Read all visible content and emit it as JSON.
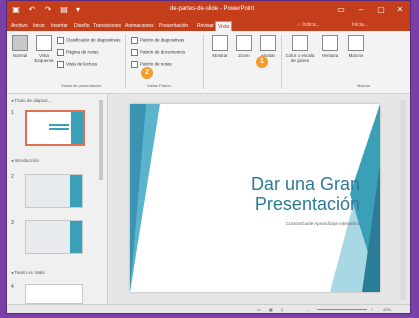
{
  "window": {
    "title": "de-partes-de-slide - PowerPoint",
    "qa_icons": [
      "save-icon",
      "undo-icon",
      "redo-icon",
      "present-icon",
      "customize-icon"
    ],
    "controls": [
      "ribbon-options-icon",
      "minimize-icon",
      "maximize-icon",
      "close-icon"
    ]
  },
  "tabs": [
    {
      "label": "Archivo",
      "active": false
    },
    {
      "label": "Inicio",
      "active": false
    },
    {
      "label": "Insertar",
      "active": false
    },
    {
      "label": "Diseño",
      "active": false
    },
    {
      "label": "Transiciones",
      "active": false
    },
    {
      "label": "Animaciones",
      "active": false
    },
    {
      "label": "Presentación",
      "active": false
    },
    {
      "label": "Revisar",
      "active": false
    },
    {
      "label": "Vista",
      "active": true
    }
  ],
  "tell_me": "♀ Indica...",
  "sign_in": "Inicia...",
  "ribbon": {
    "normal_label": "Normal",
    "outline_label": "Vista Esquema",
    "slide_sorter": "Clasificador de diapositivas",
    "notes_page": "Página de notas",
    "reading_view": "Vista de lectura",
    "views_group": "Vistas de presentación",
    "slide_master": "Patrón de diapositivas",
    "handout_master": "Patrón de documentos",
    "notes_master": "Patrón de notas",
    "master_group": "Vistas Patrón",
    "show_label": "Mostrar",
    "zoom_label": "Zoom",
    "fit_label": "Ajustar",
    "color_label": "Color o escala de grises",
    "window_label": "Ventana",
    "macros_label": "Macros",
    "macros_group": "Macros",
    "badge_1": "1",
    "badge_2": "2"
  },
  "leftpane": {
    "sections": [
      {
        "name": "◂ Título de diaposi..."
      },
      {
        "name": "◂ Introducción"
      },
      {
        "name": "◂ Teatro vs. Malo"
      }
    ],
    "slide_numbers": [
      "1",
      "2",
      "3",
      "4"
    ]
  },
  "slide": {
    "title_line1": "Dar una Gran",
    "title_line2": "Presentación",
    "subtitle": "CustomGuide Aprendizaje Interactivo"
  },
  "status": {
    "zoom": "42%"
  },
  "colors": {
    "accent": "#c43e1c",
    "slide_accent": "#2e7a96",
    "badge": "#f39c2c",
    "frame": "#7b3fa8"
  }
}
